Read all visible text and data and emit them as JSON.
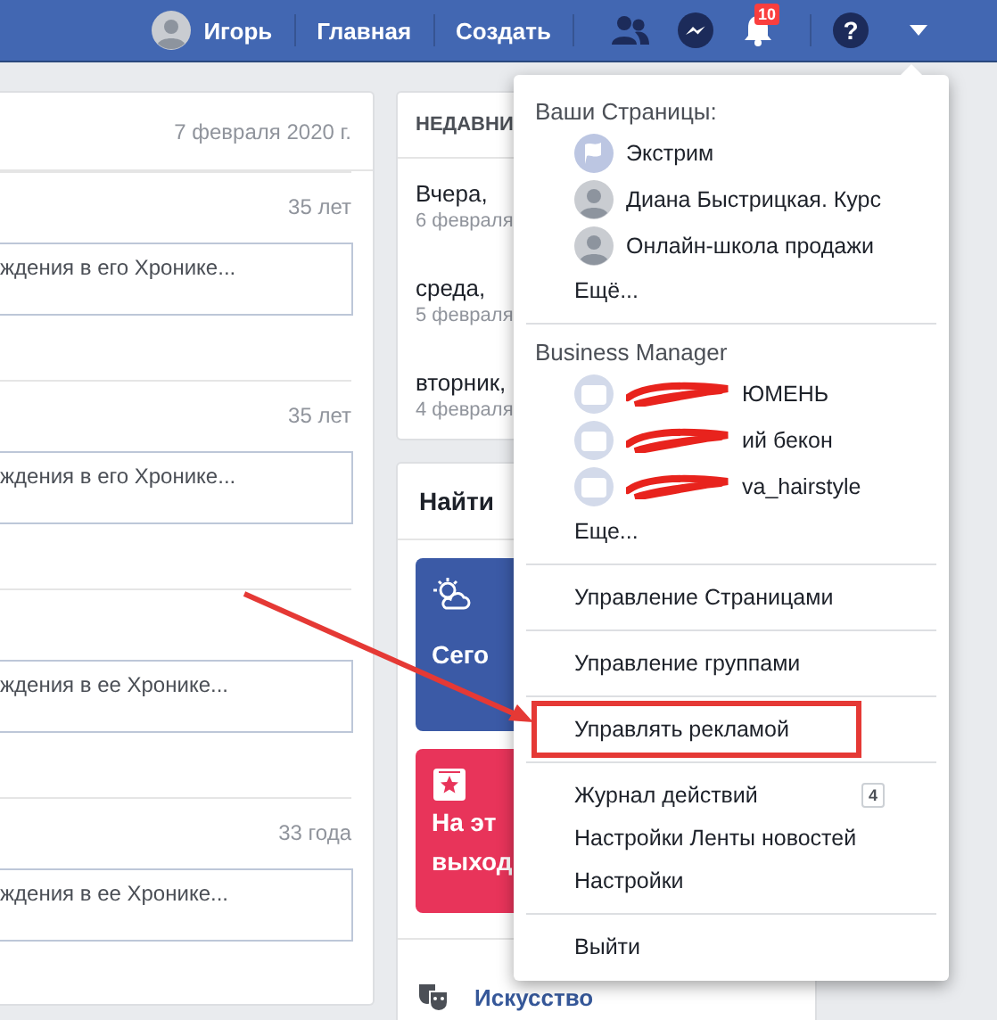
{
  "top_bar": {
    "user": "Игорь",
    "links": [
      "Главная",
      "Создать"
    ],
    "notifications_count": "10",
    "help_label": "?"
  },
  "birthdays": {
    "date": "7 февраля 2020 г.",
    "rows": [
      {
        "age": "35 лет",
        "placeholder": "ждения в его Хронике..."
      },
      {
        "age": "35 лет",
        "placeholder": "ждения в его Хронике..."
      },
      {
        "placeholder": "ждения в ее Хронике..."
      },
      {
        "age": "33 года",
        "placeholder": "ждения в ее Хронике..."
      }
    ]
  },
  "recent": {
    "title": "НЕДАВНИ",
    "items": [
      {
        "day": "Вчера,",
        "date": "6 февраля"
      },
      {
        "day": "среда,",
        "date": "5 февраля"
      },
      {
        "day": "вторник,",
        "date": "4 февраля"
      }
    ]
  },
  "find": {
    "title": "Найти",
    "tiles": [
      {
        "kind": "weather",
        "color": "#3b5aa6",
        "lines": [
          "Сего"
        ]
      },
      {
        "kind": "calendar",
        "color": "#e8345a",
        "lines": [
          "На эт",
          "выход"
        ]
      }
    ],
    "category": "Искусство"
  },
  "account_menu": {
    "sections": [
      {
        "title": "Ваши Страницы:",
        "items": [
          {
            "kind": "page",
            "avatar": {
              "kind": "flag"
            },
            "label": "Экстрим",
            "redacted": false
          },
          {
            "kind": "page",
            "avatar": {
              "kind": "person"
            },
            "label": "Диана Быстрицкая. Курс",
            "redacted": false
          },
          {
            "kind": "page",
            "avatar": {
              "kind": "person"
            },
            "label": "Онлайн-школа продажи",
            "redacted": false
          }
        ],
        "more": "Ещё..."
      },
      {
        "title": "Business Manager",
        "items": [
          {
            "kind": "page",
            "avatar": {
              "kind": "business"
            },
            "label": "ЮМЕНЬ",
            "redacted": true
          },
          {
            "kind": "page",
            "avatar": {
              "kind": "business"
            },
            "label": "ий бекон",
            "redacted": true
          },
          {
            "kind": "page",
            "avatar": {
              "kind": "business"
            },
            "label": "va_hairstyle",
            "redacted": true
          }
        ],
        "more": "Еще..."
      },
      {
        "items": [
          {
            "kind": "link",
            "label": "Управление Страницами",
            "highlighted": false
          }
        ]
      },
      {
        "items": [
          {
            "kind": "link",
            "label": "Управление группами",
            "highlighted": false
          }
        ]
      },
      {
        "items": [
          {
            "kind": "link",
            "label": "Управлять рекламой",
            "highlighted": true
          }
        ]
      },
      {
        "items": [
          {
            "kind": "link",
            "label": "Журнал действий",
            "badge": "4",
            "highlighted": false
          },
          {
            "kind": "link",
            "label": "Настройки Ленты новостей",
            "highlighted": false
          },
          {
            "kind": "link",
            "label": "Настройки",
            "highlighted": false
          }
        ]
      },
      {
        "items": [
          {
            "kind": "link",
            "label": "Выйти",
            "highlighted": false
          }
        ]
      }
    ]
  }
}
